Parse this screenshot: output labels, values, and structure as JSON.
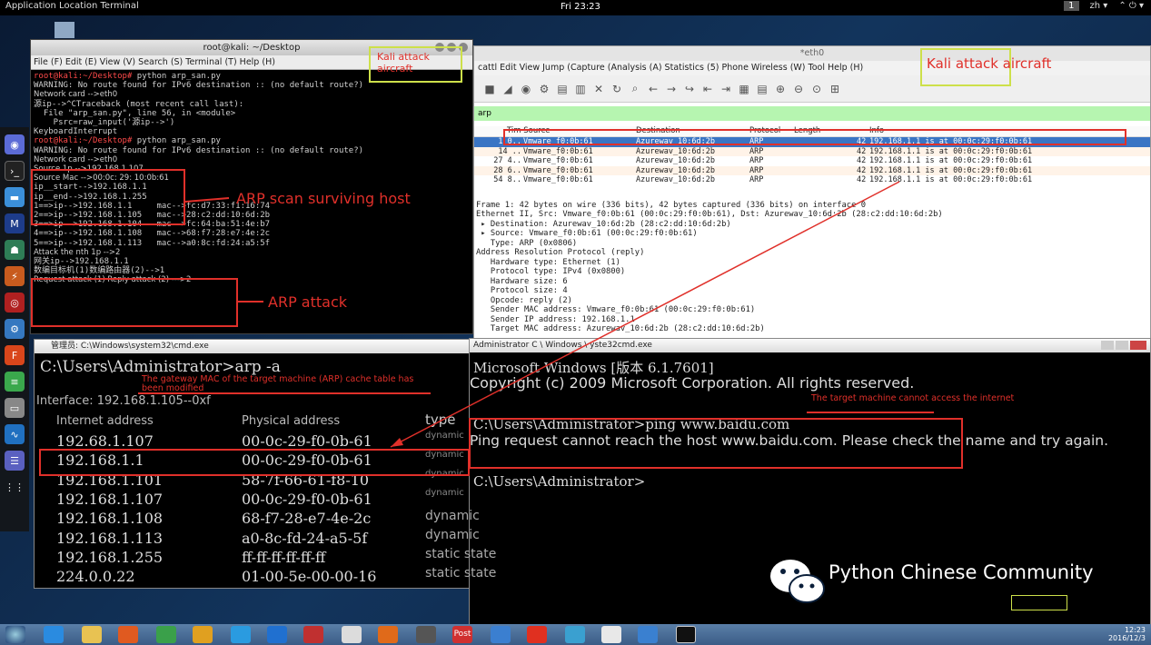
{
  "topbar": {
    "left": "Application Location Terminal",
    "clock": "Fri 23:23",
    "workspace": "1",
    "lang": "zh ▾",
    "icons": "⌃ ⏻ ▾"
  },
  "terminal": {
    "title": "root@kali: ~/Desktop",
    "menu": "File (F) Edit (E) View (V) Search (S) Terminal (T) Help (H)",
    "lines": [
      {
        "t": "root@kali:~/Desktop# python arp_san.py",
        "c": "prompt"
      },
      {
        "t": "WARNING: No route found for IPv6 destination :: (no default route?)",
        "c": ""
      },
      {
        "t": "Network card -->eth0",
        "c": "small"
      },
      {
        "t": "源ip-->^CTraceback (most recent call last):",
        "c": ""
      },
      {
        "t": "  File \"arp_san.py\", line 56, in <module>",
        "c": ""
      },
      {
        "t": "    Psrc=raw_input('源ip-->')",
        "c": ""
      },
      {
        "t": "KeyboardInterrupt",
        "c": ""
      },
      {
        "t": "root@kali:~/Desktop# python arp_san.py",
        "c": "prompt"
      },
      {
        "t": "WARNING: No route found for IPv6 destination :: (no default route?)",
        "c": ""
      },
      {
        "t": "Network card -->eth0",
        "c": "small"
      },
      {
        "t": "Source 1p -->192.168.1.107",
        "c": "small"
      },
      {
        "t": "Source Mac -->00:0c: 29: 10:0b:61",
        "c": "small"
      },
      {
        "t": "ip__start-->192.168.1.1",
        "c": ""
      },
      {
        "t": "ip__end-->192.168.1.255",
        "c": ""
      },
      {
        "t": "1==>ip-->192.168.1.1     mac-->fc:d7:33:f1:16:74",
        "c": ""
      },
      {
        "t": "2==>ip-->192.168.1.105   mac-->28:c2:dd:10:6d:2b",
        "c": ""
      },
      {
        "t": "3==>ip-->192.168.1.104   mac-->fc:64:ba:51:4e:b7",
        "c": ""
      },
      {
        "t": "4==>ip-->192.168.1.108   mac-->68:f7:28:e7:4e:2c",
        "c": ""
      },
      {
        "t": "5==>ip-->192.168.1.113   mac-->a0:8c:fd:24:a5:5f",
        "c": ""
      },
      {
        "t": "Attack the nth 1p -->2",
        "c": "small"
      },
      {
        "t": "网关ip-->192.168.1.1",
        "c": ""
      },
      {
        "t": "数编目标机(1)数编路由器(2)-->1",
        "c": ""
      },
      {
        "t": "Request attack (1) Reply attack (2) --->2",
        "c": "small"
      }
    ]
  },
  "kali_label_1": "Kali attack aircraft",
  "kali_label_2": "Kali attack aircraft",
  "wireshark": {
    "title": "*eth0",
    "menu": "cattl  Edit View Jump (Capture (Analysis (A) Statistics (5) Phone Wireless (W) Tool Help (H)",
    "filter": "arp",
    "headers": [
      "Tim Source",
      "Destination",
      "Protocol",
      "Length",
      "Info"
    ],
    "rows": [
      {
        "no": "1 0..",
        "src": "Vmware_f0:0b:61",
        "dst": "Azurewav_10:6d:2b",
        "proto": "ARP",
        "len": "42",
        "info": "192.168.1.1 is at 00:0c:29:f0:0b:61"
      },
      {
        "no": "14 ..",
        "src": "Vmware_f0:0b:61",
        "dst": "Azurewav_10:6d:2b",
        "proto": "ARP",
        "len": "42",
        "info": "192.168.1.1 is at 00:0c:29:f0:0b:61"
      },
      {
        "no": "27 4..",
        "src": "Vmware_f0:0b:61",
        "dst": "Azurewav_10:6d:2b",
        "proto": "ARP",
        "len": "42",
        "info": "192.168.1.1 is at 00:0c:29:f0:0b:61"
      },
      {
        "no": "28 6..",
        "src": "Vmware_f0:0b:61",
        "dst": "Azurewav_10:6d:2b",
        "proto": "ARP",
        "len": "42",
        "info": "192.168.1.1 is at 00:0c:29:f0:0b:61"
      },
      {
        "no": "54 8..",
        "src": "Vmware_f0:0b:61",
        "dst": "Azurewav_10:6d:2b",
        "proto": "ARP",
        "len": "42",
        "info": "192.168.1.1 is at 00:0c:29:f0:0b:61"
      }
    ],
    "details": [
      "Frame 1: 42 bytes on wire (336 bits), 42 bytes captured (336 bits) on interface 0",
      "Ethernet II, Src: Vmware_f0:0b:61 (00:0c:29:f0:0b:61), Dst: Azurewav_10:6d:2b (28:c2:dd:10:6d:2b)",
      " ▸ Destination: Azurewav_10:6d:2b (28:c2:dd:10:6d:2b)",
      " ▸ Source: Vmware_f0:0b:61 (00:0c:29:f0:0b:61)",
      "   Type: ARP (0x0806)",
      "Address Resolution Protocol (reply)",
      "   Hardware type: Ethernet (1)",
      "   Protocol type: IPv4 (0x0800)",
      "   Hardware size: 6",
      "   Protocol size: 4",
      "   Opcode: reply (2)",
      "   Sender MAC address: Vmware_f0:0b:61 (00:0c:29:f0:0b:61)",
      "   Sender IP address: 192.168.1.1",
      "   Target MAC address: Azurewav_10:6d:2b (28:c2:dd:10:6d:2b)"
    ]
  },
  "cmd1": {
    "title": "管理员: C:\\Windows\\system32\\cmd.exe",
    "prompt": "C:\\Users\\Administrator>arp -a",
    "note": "The gateway MAC of the target machine (ARP) cache table has been modified",
    "interface": "Interface: 192.168.1.105--0xf",
    "col_ip": "Internet address",
    "col_mac": "Physical address",
    "col_type": "type",
    "rows": [
      {
        "ip": "192.68.1.107",
        "mac": "00-0c-29-f0-0b-61",
        "type": "dynamic"
      },
      {
        "ip": "192.168.1.1",
        "mac": "00-0c-29-f0-0b-61",
        "type": "dynamic"
      },
      {
        "ip": "192.168.1.101",
        "mac": "58-7f-66-61-f8-10",
        "type": "dynamic"
      },
      {
        "ip": "192.168.1.107",
        "mac": "00-0c-29-f0-0b-61",
        "type": "dynamic"
      },
      {
        "ip": "192.168.1.108",
        "mac": "68-f7-28-e7-4e-2c",
        "type": "dynamic"
      },
      {
        "ip": "192.168.1.113",
        "mac": "a0-8c-fd-24-a5-5f",
        "type": "dynamic"
      },
      {
        "ip": "192.168.1.255",
        "mac": "ff-ff-ff-ff-ff-ff",
        "type": "static state"
      },
      {
        "ip": "224.0.0.22",
        "mac": "01-00-5e-00-00-16",
        "type": "static state"
      }
    ]
  },
  "cmd2": {
    "title": "Administrator C \\ Windows \\ yste32cmd.exe",
    "line1": "Microsoft Windows [版本 6.1.7601]",
    "line2": "Copyright (c) 2009 Microsoft Corporation. All rights reserved.",
    "note": "The target machine cannot access the internet",
    "ping": "C:\\Users\\Administrator>ping www.baidu.com",
    "ping_result": "Ping request cannot reach the host www.baidu.com. Please check the name and try again.",
    "prompt": "C:\\Users\\Administrator>"
  },
  "annotations": {
    "scan": "ARP scan surviving host",
    "attack": "ARP attack"
  },
  "watermark": "Python Chinese Community",
  "tray": {
    "time": "12:23",
    "date": "2016/12/3",
    "post": "Post"
  }
}
